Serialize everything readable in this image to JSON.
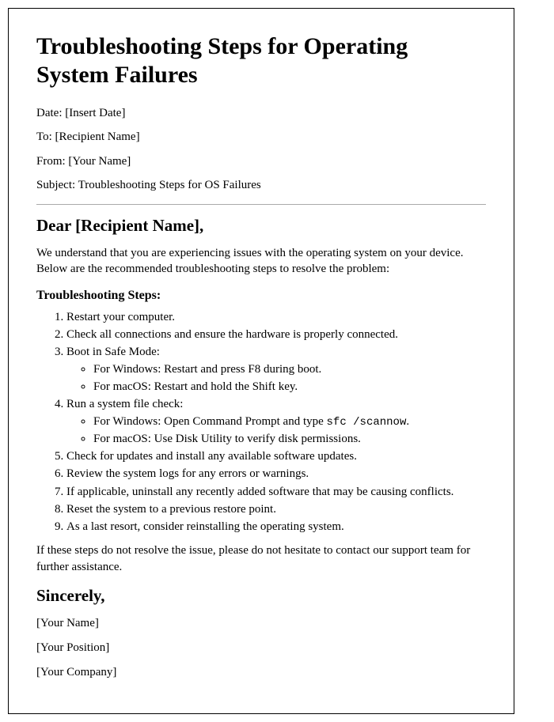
{
  "title": "Troubleshooting Steps for Operating System Failures",
  "meta": {
    "date": "Date: [Insert Date]",
    "to": "To: [Recipient Name]",
    "from": "From: [Your Name]",
    "subject": "Subject: Troubleshooting Steps for OS Failures"
  },
  "salutation": "Dear [Recipient Name],",
  "intro": "We understand that you are experiencing issues with the operating system on your device. Below are the recommended troubleshooting steps to resolve the problem:",
  "steps_heading": "Troubleshooting Steps:",
  "steps": {
    "s1": "Restart your computer.",
    "s2": "Check all connections and ensure the hardware is properly connected.",
    "s3": "Boot in Safe Mode:",
    "s3a": "For Windows: Restart and press F8 during boot.",
    "s3b": "For macOS: Restart and hold the Shift key.",
    "s4": "Run a system file check:",
    "s4a_pre": "For Windows: Open Command Prompt and type ",
    "s4a_code": "sfc /scannow",
    "s4a_post": ".",
    "s4b": "For macOS: Use Disk Utility to verify disk permissions.",
    "s5": "Check for updates and install any available software updates.",
    "s6": "Review the system logs for any errors or warnings.",
    "s7": "If applicable, uninstall any recently added software that may be causing conflicts.",
    "s8": "Reset the system to a previous restore point.",
    "s9": "As a last resort, consider reinstalling the operating system."
  },
  "closing_note": "If these steps do not resolve the issue, please do not hesitate to contact our support team for further assistance.",
  "signoff": "Sincerely,",
  "signature": {
    "name": "[Your Name]",
    "position": "[Your Position]",
    "company": "[Your Company]"
  }
}
